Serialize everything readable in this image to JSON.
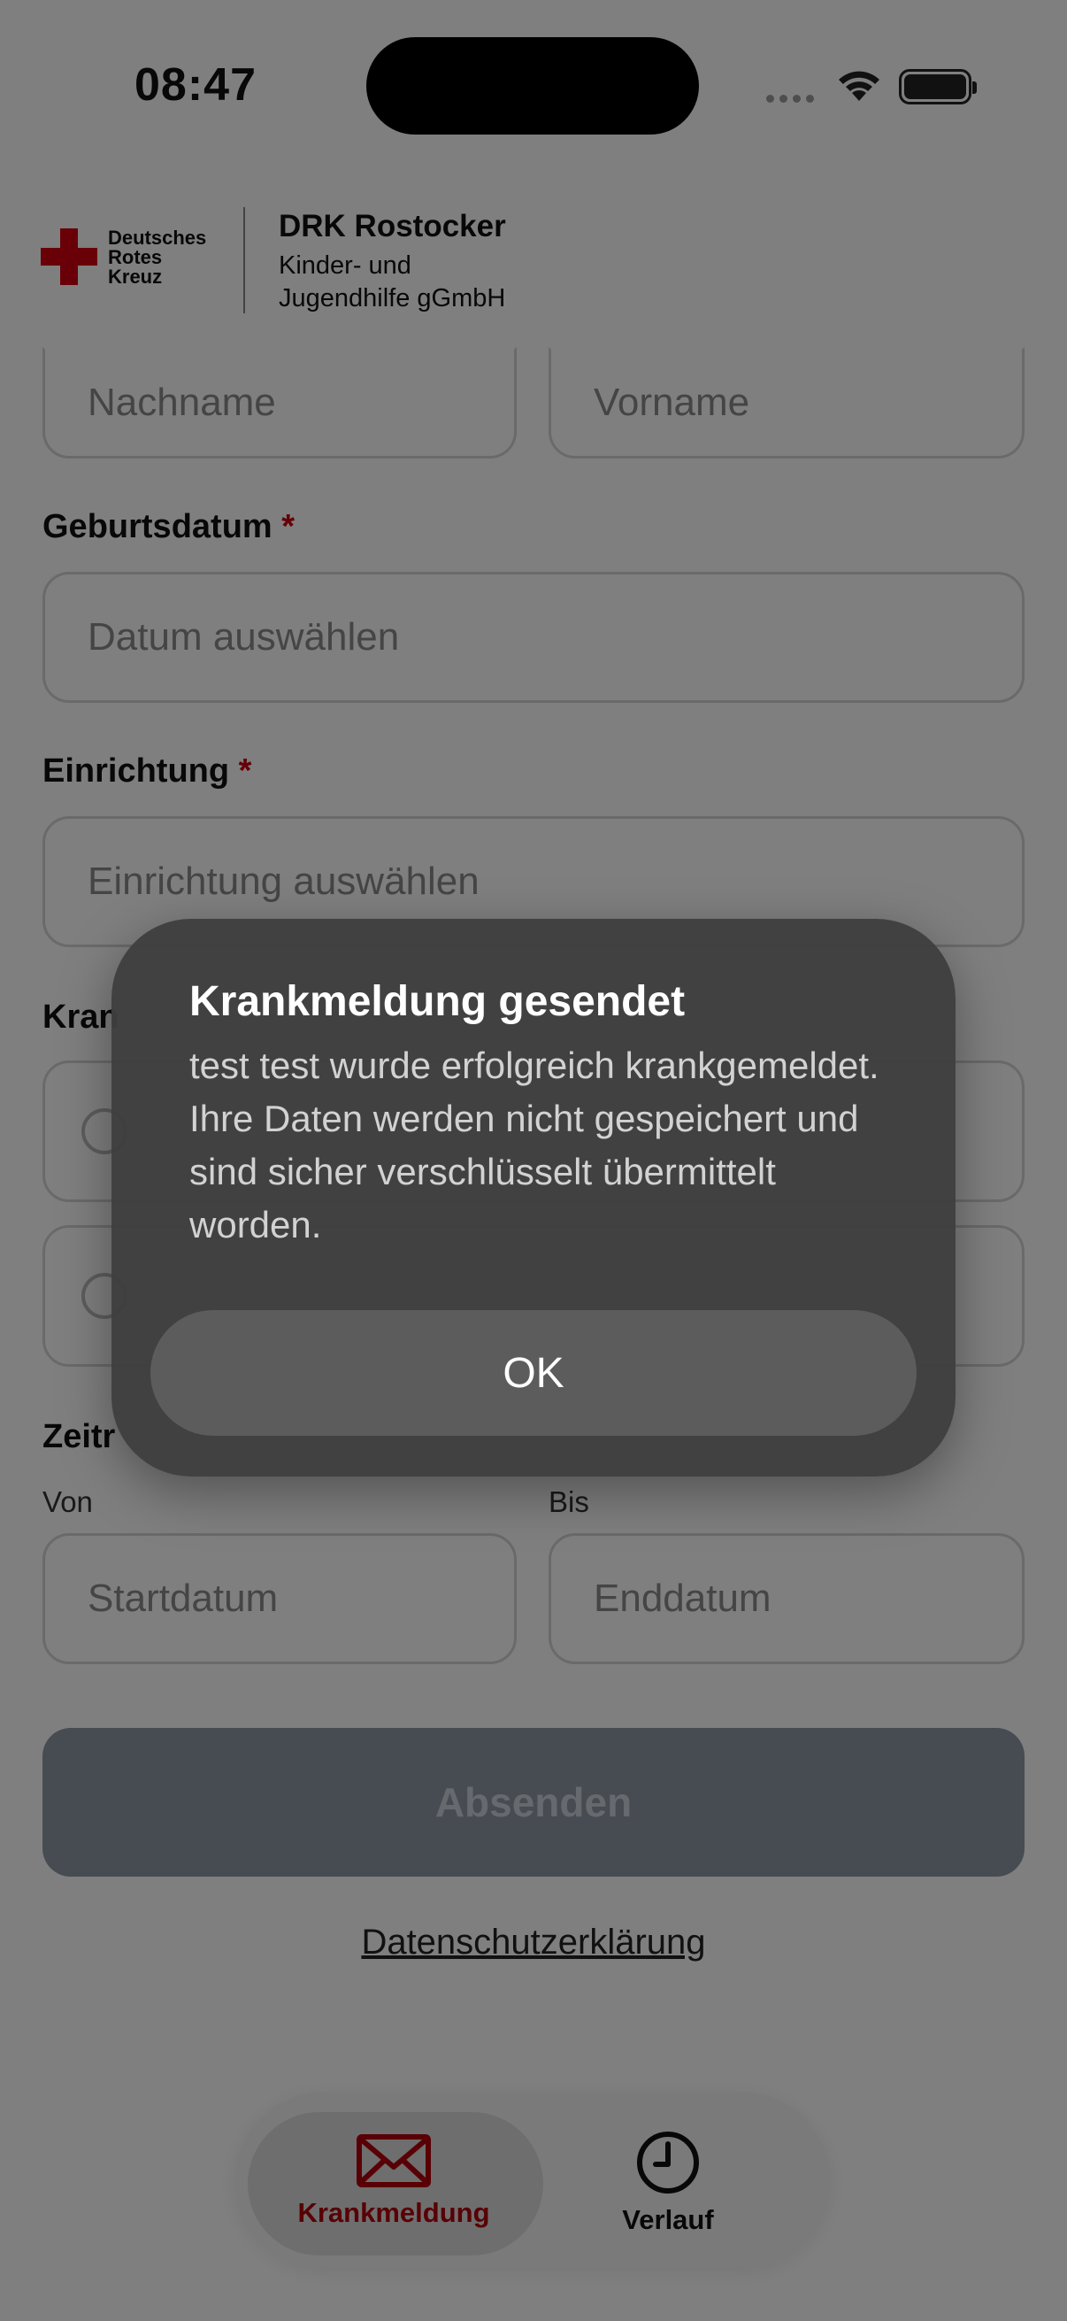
{
  "status_bar": {
    "time": "08:47"
  },
  "header": {
    "logo_text": [
      "Deutsches",
      "Rotes",
      "Kreuz"
    ],
    "org_name": "DRK Rostocker",
    "org_sub_line1": "Kinder- und",
    "org_sub_line2": "Jugendhilfe gGmbH"
  },
  "form": {
    "lastname_placeholder": "Nachname",
    "firstname_placeholder": "Vorname",
    "birthdate_label": "Geburtsdatum",
    "birthdate_placeholder": "Datum auswählen",
    "facility_label": "Einrichtung",
    "facility_placeholder": "Einrichtung auswählen",
    "sick_label": "Kran",
    "period_label": "Zeitr",
    "from_label": "Von",
    "to_label": "Bis",
    "start_placeholder": "Startdatum",
    "end_placeholder": "Enddatum",
    "required_marker": "*",
    "submit_label": "Absenden",
    "privacy_link": "Datenschutzerklärung"
  },
  "tabbar": {
    "tabs": [
      {
        "label": "Krankmeldung",
        "icon": "envelope-icon",
        "active": true
      },
      {
        "label": "Verlauf",
        "icon": "clock-icon",
        "active": false
      }
    ]
  },
  "dialog": {
    "title": "Krankmeldung gesendet",
    "message": "test test wurde erfolgreich krankgemeldet. Ihre Daten werden nicht gespeichert und sind sicher verschlüsselt übermittelt worden.",
    "ok_label": "OK"
  },
  "colors": {
    "brand_red": "#d3000e",
    "accent_red": "#b0000b",
    "submit_disabled": "#8e98a5"
  }
}
